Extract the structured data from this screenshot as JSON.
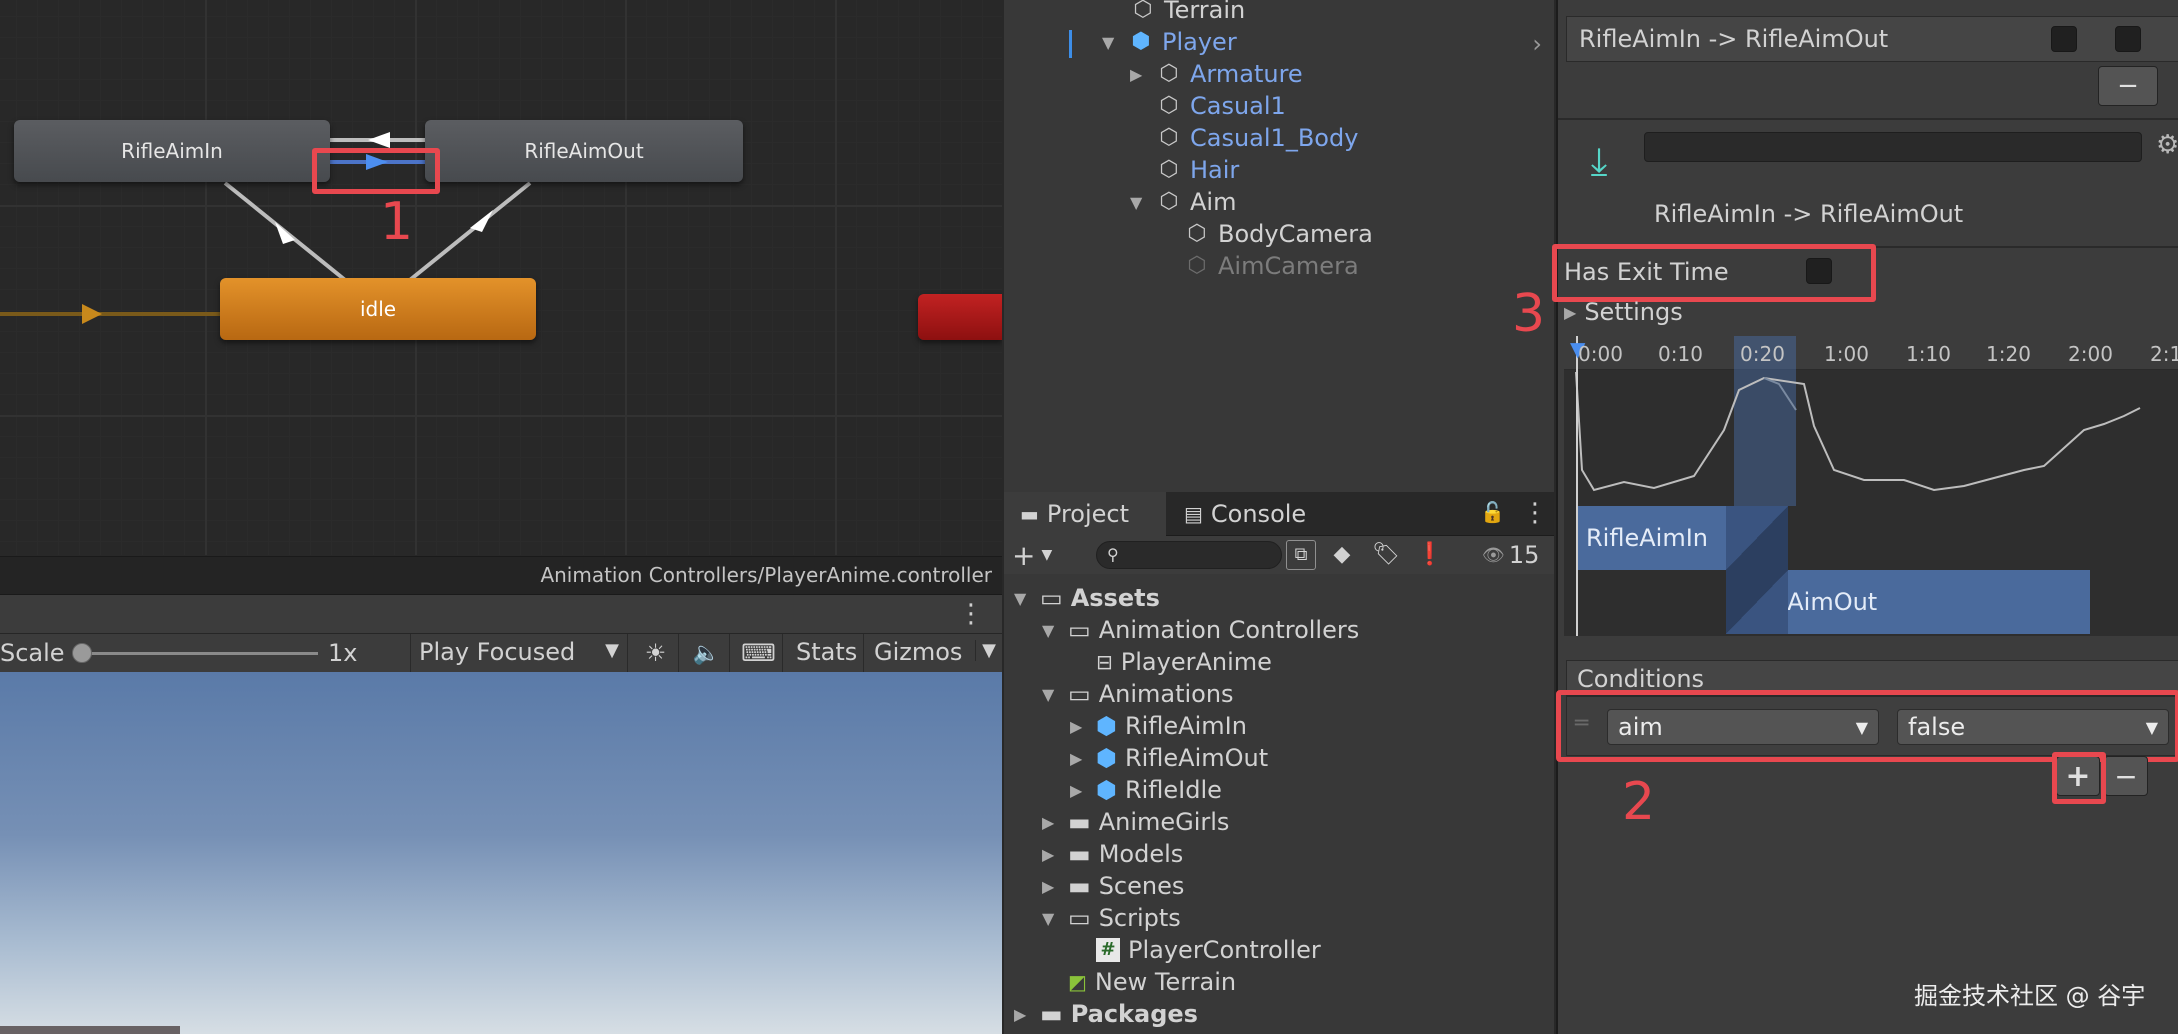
{
  "animator": {
    "states": {
      "rifle_aim_in": "RifleAimIn",
      "rifle_aim_out": "RifleAimOut",
      "idle": "idle"
    },
    "path": "Animation Controllers/PlayerAnime.controller",
    "annotation_1": "1"
  },
  "game_toolbar": {
    "scale_label": "Scale",
    "scale_value": "1x",
    "play_mode": "Play Focused",
    "stats_label": "Stats",
    "gizmos_label": "Gizmos"
  },
  "hierarchy": {
    "items": [
      {
        "label": "Terrain"
      },
      {
        "label": "Player"
      },
      {
        "label": "Armature"
      },
      {
        "label": "Casual1"
      },
      {
        "label": "Casual1_Body"
      },
      {
        "label": "Hair"
      },
      {
        "label": "Aim"
      },
      {
        "label": "BodyCamera"
      },
      {
        "label": "AimCamera"
      }
    ]
  },
  "project": {
    "tabs": {
      "project": "Project",
      "console": "Console"
    },
    "search_placeholder": "",
    "hidden_count": "15",
    "tree": [
      {
        "label": "Assets"
      },
      {
        "label": "Animation Controllers"
      },
      {
        "label": "PlayerAnime"
      },
      {
        "label": "Animations"
      },
      {
        "label": "RifleAimIn"
      },
      {
        "label": "RifleAimOut"
      },
      {
        "label": "RifleIdle"
      },
      {
        "label": "AnimeGirls"
      },
      {
        "label": "Models"
      },
      {
        "label": "Scenes"
      },
      {
        "label": "Scripts"
      },
      {
        "label": "PlayerController"
      },
      {
        "label": "New Terrain"
      },
      {
        "label": "Packages"
      }
    ]
  },
  "inspector": {
    "transition_list_item": "RifleAimIn -> RifleAimOut",
    "minus_label": "−",
    "name_field_value": "",
    "subtitle": "RifleAimIn -> RifleAimOut",
    "has_exit_time_label": "Has Exit Time",
    "has_exit_time_checked": false,
    "settings_label": "Settings",
    "annotation_3": "3",
    "timeline_ticks": [
      "0:00",
      "0:10",
      "0:20",
      "1:00",
      "1:10",
      "1:20",
      "2:00",
      "2:1"
    ],
    "clip_in": "RifleAimIn",
    "clip_out": "RifleAimOut",
    "conditions_label": "Conditions",
    "condition": {
      "parameter": "aim",
      "value": "false"
    },
    "plus_label": "+",
    "annotation_2": "2",
    "watermark": "掘金技术社区 @ 谷宇"
  },
  "colors": {
    "annotation_red": "#e8484f",
    "idle_state": "#e3922a",
    "selected_blue": "#7ea6ec",
    "clip_blue": "#4a6a9c"
  }
}
